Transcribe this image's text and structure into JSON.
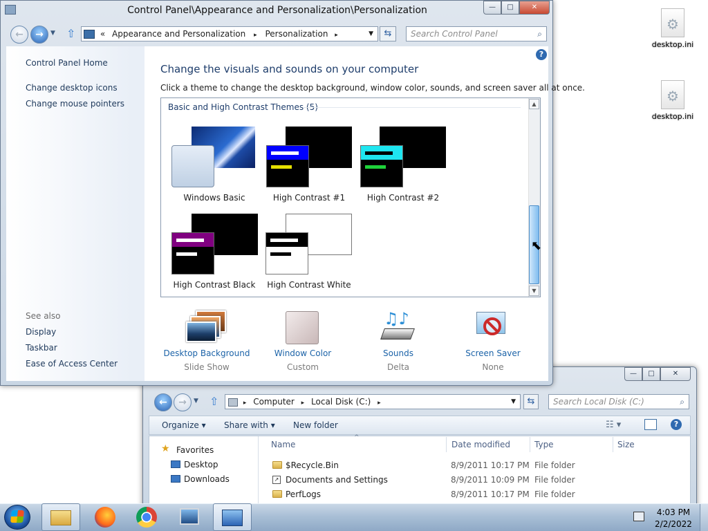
{
  "desktop": {
    "icons": [
      {
        "label": "desktop.ini",
        "icon": "settings-file-icon"
      },
      {
        "label": "desktop.ini",
        "icon": "settings-file-icon"
      }
    ]
  },
  "personalization_window": {
    "title": "Control Panel\\Appearance and Personalization\\Personalization",
    "controls": {
      "minimize": "—",
      "maximize": "□",
      "close": "✕"
    },
    "address": {
      "chevrons": "«",
      "crumbs": [
        "Appearance and Personalization",
        "Personalization"
      ],
      "separator": "▸"
    },
    "search_placeholder": "Search Control Panel",
    "left_nav": {
      "home": "Control Panel Home",
      "links": [
        "Change desktop icons",
        "Change mouse pointers"
      ],
      "see_also_heading": "See also",
      "see_also": [
        "Display",
        "Taskbar",
        "Ease of Access Center"
      ]
    },
    "heading": "Change the visuals and sounds on your computer",
    "description": "Click a theme to change the desktop background, window color, sounds, and screen saver all at once.",
    "themes_group": {
      "title": "Basic and High Contrast Themes (5)",
      "themes": [
        {
          "name": "Windows Basic"
        },
        {
          "name": "High Contrast #1"
        },
        {
          "name": "High Contrast #2"
        },
        {
          "name": "High Contrast Black"
        },
        {
          "name": "High Contrast White"
        }
      ]
    },
    "bottom": [
      {
        "label": "Desktop Background",
        "value": "Slide Show",
        "icon": "photos-icon"
      },
      {
        "label": "Window Color",
        "value": "Custom",
        "icon": "color-swatch-icon"
      },
      {
        "label": "Sounds",
        "value": "Delta",
        "icon": "music-notes-icon"
      },
      {
        "label": "Screen Saver",
        "value": "None",
        "icon": "no-screensaver-icon"
      }
    ],
    "help": "?"
  },
  "explorer_window": {
    "controls": {
      "minimize": "—",
      "maximize": "□",
      "close": "✕"
    },
    "address": {
      "crumbs": [
        "Computer",
        "Local Disk (C:)"
      ],
      "separator": "▸"
    },
    "search_placeholder": "Search Local Disk (C:)",
    "toolbar": {
      "organize": "Organize ▾",
      "share": "Share with ▾",
      "new_folder": "New folder",
      "help": "?"
    },
    "nav": {
      "favorites": "Favorites",
      "items": [
        "Desktop",
        "Downloads"
      ]
    },
    "columns": [
      "Name",
      "Date modified",
      "Type",
      "Size"
    ],
    "rows": [
      {
        "name": "$Recycle.Bin",
        "date": "8/9/2011 10:17 PM",
        "type": "File folder"
      },
      {
        "name": "Documents and Settings",
        "date": "8/9/2011 10:09 PM",
        "type": "File folder"
      },
      {
        "name": "PerfLogs",
        "date": "8/9/2011 10:17 PM",
        "type": "File folder"
      }
    ]
  },
  "taskbar": {
    "time": "4:03 PM",
    "date": "2/2/2022",
    "apps": [
      "file-explorer-icon",
      "firefox-icon",
      "chrome-icon",
      "network-computer-icon",
      "control-panel-icon"
    ]
  },
  "colors": {
    "accent": "#1c4f8d",
    "link": "#1c63a8",
    "taskbar": "#3d6fa3"
  }
}
